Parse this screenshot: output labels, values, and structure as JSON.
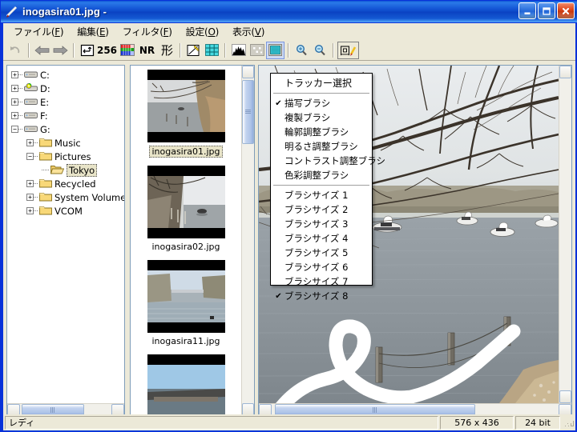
{
  "window": {
    "title": "inogasira01.jpg -",
    "icon": "pencil-icon",
    "buttons": {
      "minimize": "minimize-icon",
      "maximize": "maximize-icon",
      "close": "close-icon"
    },
    "accent_color": "#0831d9",
    "face_color": "#ece9d8"
  },
  "menubar": {
    "items": [
      {
        "label": "ファイル",
        "accel": "F"
      },
      {
        "label": "編集",
        "accel": "E"
      },
      {
        "label": "フィルタ",
        "accel": "F"
      },
      {
        "label": "設定",
        "accel": "O"
      },
      {
        "label": "表示",
        "accel": "V"
      }
    ]
  },
  "toolbar": {
    "buttons": [
      {
        "name": "undo-button",
        "glyph": "↶",
        "kind": "icon",
        "disabled": true
      },
      {
        "name": "back-button",
        "glyph": "⬅",
        "kind": "icon"
      },
      {
        "name": "forward-button",
        "glyph": "➡",
        "kind": "icon"
      },
      {
        "name": "resize-button",
        "glyph": "⬌↑",
        "kind": "icon"
      },
      {
        "name": "color-256-button",
        "label": "256",
        "kind": "text"
      },
      {
        "name": "palette-button",
        "glyph": "▦",
        "kind": "icon"
      },
      {
        "name": "noise-reduction-button",
        "label": "NR",
        "kind": "text"
      },
      {
        "name": "shape-button",
        "label": "形",
        "kind": "text-jp"
      },
      {
        "name": "tone-curve-button",
        "glyph": "✎",
        "kind": "icon"
      },
      {
        "name": "grid-button",
        "glyph": "▩",
        "kind": "icon"
      },
      {
        "name": "histogram-button",
        "glyph": "▂▅█",
        "kind": "icon"
      },
      {
        "name": "dither-button",
        "glyph": "⁘",
        "kind": "icon"
      },
      {
        "name": "screen-button",
        "glyph": "▣",
        "kind": "icon",
        "pressed": true
      },
      {
        "name": "zoom-in-button",
        "glyph": "🔍+",
        "kind": "icon"
      },
      {
        "name": "zoom-out-button",
        "glyph": "🔍-",
        "kind": "icon"
      },
      {
        "name": "tracker-button",
        "label": "回",
        "kind": "text-jp"
      }
    ]
  },
  "tree": {
    "nodes": [
      {
        "label": "C:",
        "type": "drive",
        "depth": 0,
        "state": "collapsed"
      },
      {
        "label": "D:",
        "type": "cddrive",
        "depth": 0,
        "state": "collapsed"
      },
      {
        "label": "E:",
        "type": "drive",
        "depth": 0,
        "state": "collapsed"
      },
      {
        "label": "F:",
        "type": "drive",
        "depth": 0,
        "state": "collapsed"
      },
      {
        "label": "G:",
        "type": "drive",
        "depth": 0,
        "state": "expanded"
      },
      {
        "label": "Music",
        "type": "folder",
        "depth": 1,
        "state": "collapsed"
      },
      {
        "label": "Pictures",
        "type": "folder",
        "depth": 1,
        "state": "expanded"
      },
      {
        "label": "Tokyo",
        "type": "folder-open",
        "depth": 2,
        "state": "leaf",
        "selected": true
      },
      {
        "label": "Recycled",
        "type": "folder",
        "depth": 1,
        "state": "collapsed"
      },
      {
        "label": "System Volume I",
        "type": "folder",
        "depth": 1,
        "state": "collapsed"
      },
      {
        "label": "VCOM",
        "type": "folder",
        "depth": 1,
        "state": "collapsed"
      }
    ]
  },
  "thumbnails": {
    "items": [
      {
        "caption": "inogasira01.jpg",
        "selected": true,
        "scene": "lake-trees"
      },
      {
        "caption": "inogasira02.jpg",
        "selected": false,
        "scene": "path-boats"
      },
      {
        "caption": "inogasira11.jpg",
        "selected": false,
        "scene": "river-sky"
      },
      {
        "caption": "",
        "selected": false,
        "scene": "bridge"
      }
    ]
  },
  "context_menu": {
    "title": "トラッカー選択",
    "brush_types": [
      {
        "label": "描写ブラシ",
        "checked": true
      },
      {
        "label": "複製ブラシ",
        "checked": false
      },
      {
        "label": "輪郭調整ブラシ",
        "checked": false
      },
      {
        "label": "明るさ調整ブラシ",
        "checked": false
      },
      {
        "label": "コントラスト調整ブラシ",
        "checked": false
      },
      {
        "label": "色彩調整ブラシ",
        "checked": false
      }
    ],
    "brush_sizes": [
      {
        "label": "ブラシサイズ 1",
        "checked": false
      },
      {
        "label": "ブラシサイズ 2",
        "checked": false
      },
      {
        "label": "ブラシサイズ 3",
        "checked": false
      },
      {
        "label": "ブラシサイズ 4",
        "checked": false
      },
      {
        "label": "ブラシサイズ 5",
        "checked": false
      },
      {
        "label": "ブラシサイズ 6",
        "checked": false
      },
      {
        "label": "ブラシサイズ 7",
        "checked": false
      },
      {
        "label": "ブラシサイズ 8",
        "checked": true
      }
    ],
    "check_glyph": "✔"
  },
  "image": {
    "description": "inogasira01.jpg — bare winter trees over Inokashira pond with white swan pedal boats",
    "annotation": "white brush stroke loop drawn over water",
    "stroke_color": "#ffffff"
  },
  "statusbar": {
    "ready": "レディ",
    "dimensions": "576 x 436",
    "depth": "24 bit"
  }
}
